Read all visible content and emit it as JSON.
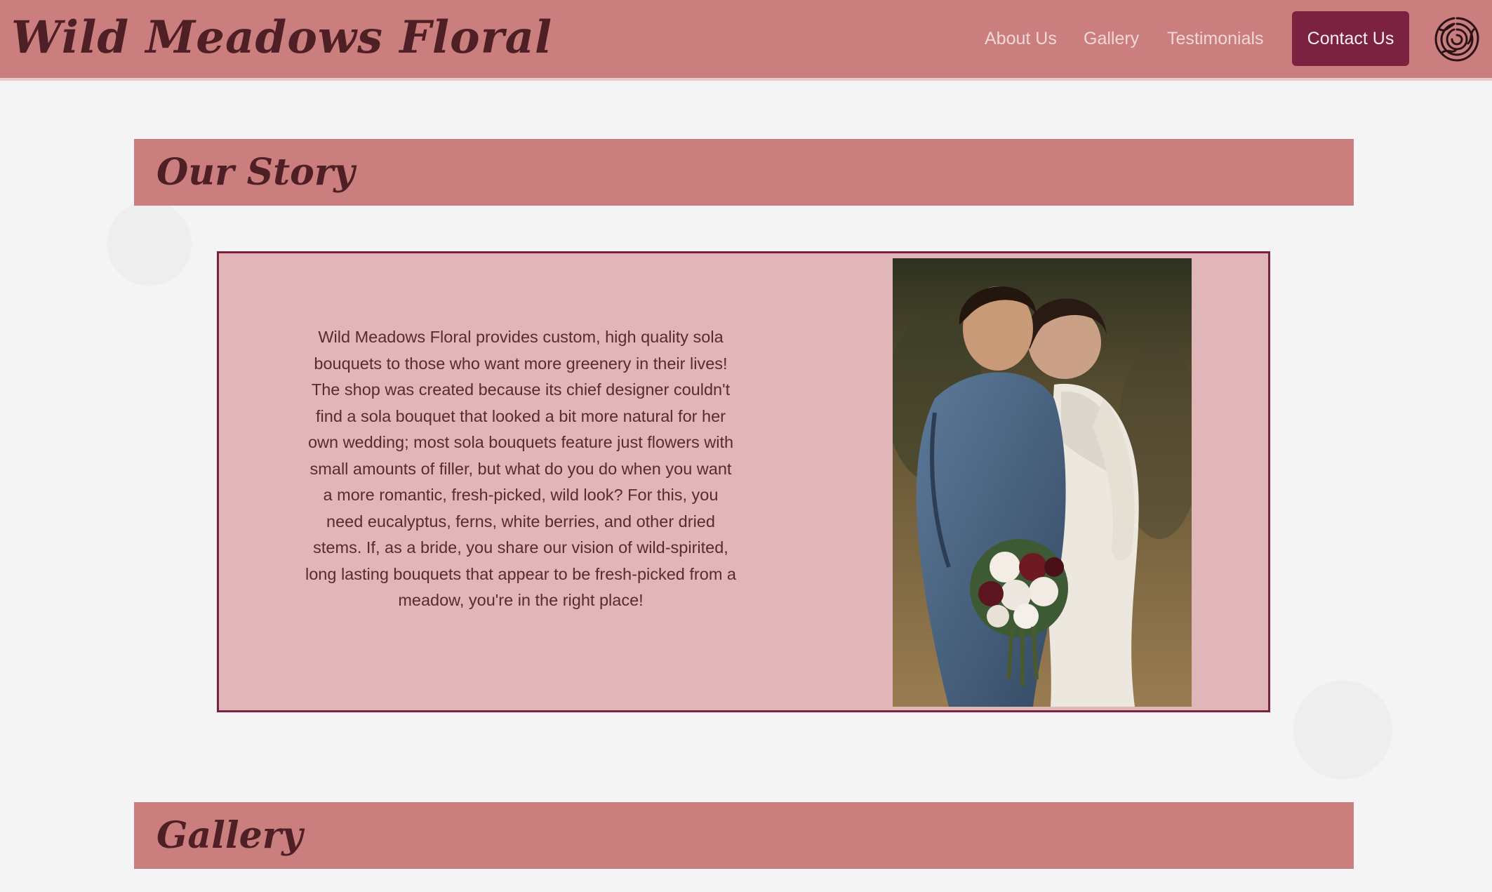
{
  "header": {
    "brand": "Wild Meadows Floral",
    "nav": {
      "about": "About Us",
      "gallery": "Gallery",
      "testimonials": "Testimonials",
      "contact": "Contact Us"
    },
    "logo_icon": "rose-icon"
  },
  "sections": {
    "story_title": "Our Story",
    "story_text": "Wild Meadows Floral provides custom, high quality sola bouquets to those who want more greenery in their lives! The shop was created because its chief designer couldn't find a sola bouquet that looked a bit more natural for her own wedding; most sola bouquets feature just flowers with small amounts of filler, but what do you do when you want a more romantic, fresh-picked, wild look? For this, you need eucalyptus, ferns, white berries, and other dried stems. If, as a bride, you share our vision of wild-spirited, long lasting bouquets that appear to be fresh-picked from a meadow, you're in the right place!",
    "gallery_title": "Gallery"
  },
  "colors": {
    "header_bg": "#cb7e7e",
    "brand_text": "#4f1f26",
    "accent": "#7a2240",
    "card_bg": "#e1b6b8",
    "nav_text": "#f1d8d8"
  }
}
